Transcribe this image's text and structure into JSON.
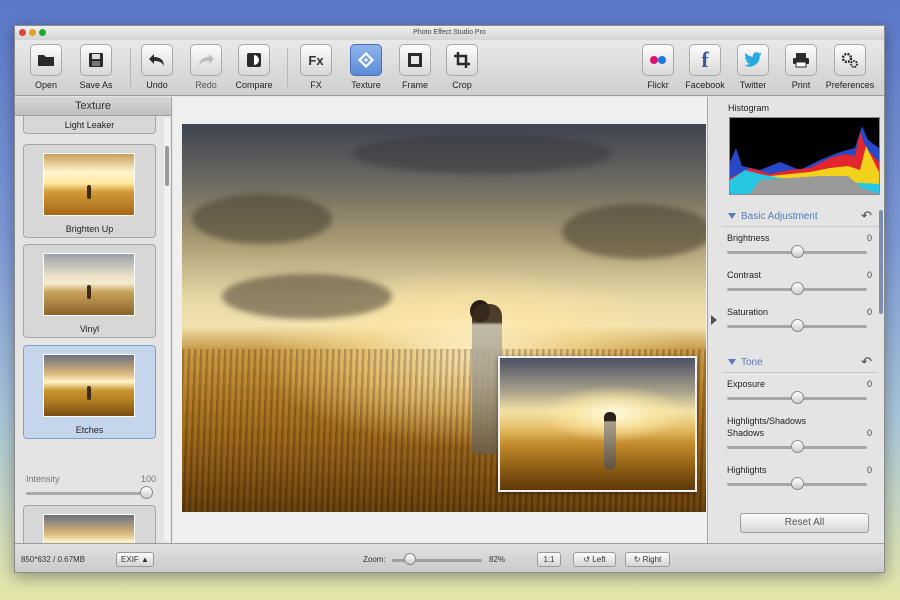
{
  "window": {
    "title": "Photo Effect Studio Pro"
  },
  "toolbar": {
    "buttons": [
      {
        "label": "Open",
        "icon": "folder-icon"
      },
      {
        "label": "Save As",
        "icon": "floppy-disk-icon"
      },
      {
        "label": "Undo",
        "icon": "undo-arrow-icon"
      },
      {
        "label": "Redo",
        "icon": "redo-arrow-icon"
      },
      {
        "label": "Compare",
        "icon": "compare-icon"
      },
      {
        "label": "FX",
        "icon": "fx-icon"
      },
      {
        "label": "Texture",
        "icon": "texture-icon"
      },
      {
        "label": "Frame",
        "icon": "frame-icon"
      },
      {
        "label": "Crop",
        "icon": "crop-icon"
      },
      {
        "label": "Flickr",
        "icon": "flickr-icon"
      },
      {
        "label": "Facebook",
        "icon": "facebook-icon"
      },
      {
        "label": "Twitter",
        "icon": "twitter-bird-icon"
      },
      {
        "label": "Print",
        "icon": "printer-icon"
      },
      {
        "label": "Preferences",
        "icon": "gears-icon"
      }
    ],
    "fx_glyph": "Fx",
    "facebook_glyph": "f",
    "active": "Texture"
  },
  "sidebar": {
    "title": "Texture",
    "items": [
      {
        "label": "Light Leaker"
      },
      {
        "label": "Brighten Up"
      },
      {
        "label": "Vinyl"
      },
      {
        "label": "Etches"
      }
    ],
    "selected": "Etches",
    "intensity": {
      "label": "Intensity",
      "value": "100",
      "fraction": 1.0
    }
  },
  "panel": {
    "histogram_title": "Histogram",
    "sections": [
      {
        "title": "Basic Adjustment",
        "adjustments": [
          {
            "label": "Brightness",
            "value": "0"
          },
          {
            "label": "Contrast",
            "value": "0"
          },
          {
            "label": "Saturation",
            "value": "0"
          }
        ]
      },
      {
        "title": "Tone",
        "adjustments": [
          {
            "label": "Exposure",
            "value": "0"
          }
        ],
        "subsection": "Highlights/Shadows",
        "sub_adjustments": [
          {
            "label": "Shadows",
            "value": "0"
          },
          {
            "label": "Highlights",
            "value": "0"
          }
        ]
      }
    ],
    "slider_fraction": 0.5,
    "reset_all": "Reset All"
  },
  "status": {
    "image_info": "850*632 / 0.67MB",
    "exif": "EXIF ▲",
    "zoom_label": "Zoom:",
    "zoom_value": "82%",
    "zoom_fraction": 0.2,
    "one_to_one": "1:1",
    "rotate_left": "Left",
    "rotate_right": "Right"
  },
  "colors": {
    "accent": "#5a79b8",
    "histogram_red": "#e3262d",
    "histogram_yellow": "#f2d21b",
    "histogram_cyan": "#27c6e2",
    "histogram_blue": "#2848c8",
    "histogram_gray": "#9a9a9a"
  }
}
